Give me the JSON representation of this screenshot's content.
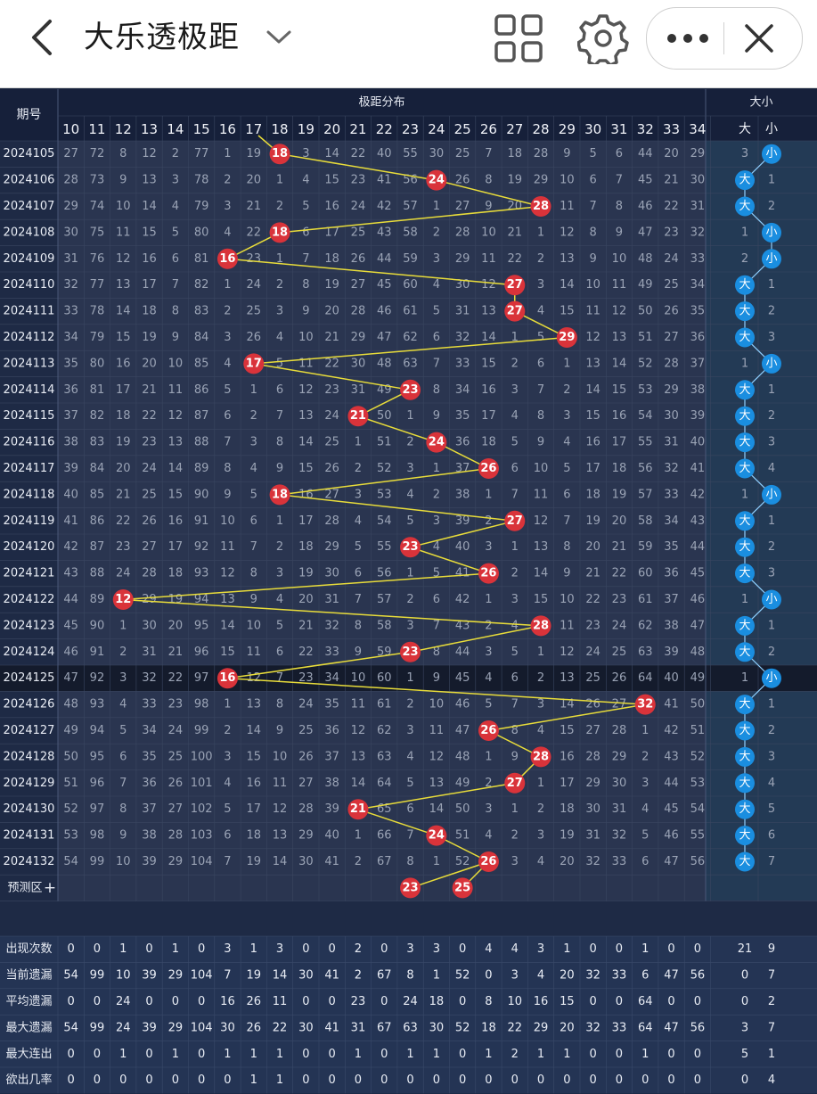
{
  "app": {
    "title": "大乐透极距",
    "back_icon": "back-arrow-icon",
    "dropdown_icon": "chevron-down-icon",
    "grid_icon": "grid-icon",
    "settings_icon": "gear-icon",
    "more_icon": "more-dots-icon",
    "close_icon": "close-icon"
  },
  "colors": {
    "bg": "#1c2740",
    "header_bg": "#16203a",
    "cell_bg": "#2a3550",
    "left_col": "#1e2a45",
    "highlight_row": "#141b2c",
    "ball_red": "#d9333a",
    "ball_blue": "#1a8ee0",
    "line": "#e8dc3a"
  },
  "table": {
    "period_header": "期号",
    "dist_header": "极距分布",
    "bigsmall_header": "大小",
    "columns": [
      "10",
      "11",
      "12",
      "13",
      "14",
      "15",
      "16",
      "17",
      "18",
      "19",
      "20",
      "21",
      "22",
      "23",
      "24",
      "25",
      "26",
      "27",
      "28",
      "29",
      "30",
      "31",
      "32",
      "33",
      "34"
    ],
    "bs_columns": [
      "大",
      "小"
    ],
    "highlight_row": "2024125",
    "rows": [
      {
        "p": "2024105",
        "v": [
          "27",
          "72",
          "8",
          "12",
          "2",
          "77",
          "1",
          "19",
          "18",
          "3",
          "14",
          "22",
          "40",
          "55",
          "30",
          "25",
          "7",
          "18",
          "28",
          "9",
          "5",
          "6",
          "44",
          "20",
          "29"
        ],
        "d": "3",
        "x": "小",
        "hit": "18"
      },
      {
        "p": "2024106",
        "v": [
          "28",
          "73",
          "9",
          "13",
          "3",
          "78",
          "2",
          "20",
          "1",
          "4",
          "15",
          "23",
          "41",
          "56",
          "24",
          "26",
          "8",
          "19",
          "29",
          "10",
          "6",
          "7",
          "45",
          "21",
          "30"
        ],
        "d": "大",
        "x": "1",
        "hit": "24"
      },
      {
        "p": "2024107",
        "v": [
          "29",
          "74",
          "10",
          "14",
          "4",
          "79",
          "3",
          "21",
          "2",
          "5",
          "16",
          "24",
          "42",
          "57",
          "1",
          "27",
          "9",
          "20",
          "28",
          "11",
          "7",
          "8",
          "46",
          "22",
          "31"
        ],
        "d": "大",
        "x": "2",
        "hit": "28"
      },
      {
        "p": "2024108",
        "v": [
          "30",
          "75",
          "11",
          "15",
          "5",
          "80",
          "4",
          "22",
          "18",
          "6",
          "17",
          "25",
          "43",
          "58",
          "2",
          "28",
          "10",
          "21",
          "1",
          "12",
          "8",
          "9",
          "47",
          "23",
          "32"
        ],
        "d": "1",
        "x": "小",
        "hit": "18"
      },
      {
        "p": "2024109",
        "v": [
          "31",
          "76",
          "12",
          "16",
          "6",
          "81",
          "16",
          "23",
          "1",
          "7",
          "18",
          "26",
          "44",
          "59",
          "3",
          "29",
          "11",
          "22",
          "2",
          "13",
          "9",
          "10",
          "48",
          "24",
          "33"
        ],
        "d": "2",
        "x": "小",
        "hit": "16"
      },
      {
        "p": "2024110",
        "v": [
          "32",
          "77",
          "13",
          "17",
          "7",
          "82",
          "1",
          "24",
          "2",
          "8",
          "19",
          "27",
          "45",
          "60",
          "4",
          "30",
          "12",
          "27",
          "3",
          "14",
          "10",
          "11",
          "49",
          "25",
          "34"
        ],
        "d": "大",
        "x": "1",
        "hit": "27"
      },
      {
        "p": "2024111",
        "v": [
          "33",
          "78",
          "14",
          "18",
          "8",
          "83",
          "2",
          "25",
          "3",
          "9",
          "20",
          "28",
          "46",
          "61",
          "5",
          "31",
          "13",
          "27",
          "4",
          "15",
          "11",
          "12",
          "50",
          "26",
          "35"
        ],
        "d": "大",
        "x": "2",
        "hit": "27"
      },
      {
        "p": "2024112",
        "v": [
          "34",
          "79",
          "15",
          "19",
          "9",
          "84",
          "3",
          "26",
          "4",
          "10",
          "21",
          "29",
          "47",
          "62",
          "6",
          "32",
          "14",
          "1",
          "5",
          "29",
          "12",
          "13",
          "51",
          "27",
          "36"
        ],
        "d": "大",
        "x": "3",
        "hit": "29"
      },
      {
        "p": "2024113",
        "v": [
          "35",
          "80",
          "16",
          "20",
          "10",
          "85",
          "4",
          "17",
          "5",
          "11",
          "22",
          "30",
          "48",
          "63",
          "7",
          "33",
          "15",
          "2",
          "6",
          "1",
          "13",
          "14",
          "52",
          "28",
          "37"
        ],
        "d": "1",
        "x": "小",
        "hit": "17"
      },
      {
        "p": "2024114",
        "v": [
          "36",
          "81",
          "17",
          "21",
          "11",
          "86",
          "5",
          "1",
          "6",
          "12",
          "23",
          "31",
          "49",
          "23",
          "8",
          "34",
          "16",
          "3",
          "7",
          "2",
          "14",
          "15",
          "53",
          "29",
          "38"
        ],
        "d": "大",
        "x": "1",
        "hit": "23"
      },
      {
        "p": "2024115",
        "v": [
          "37",
          "82",
          "18",
          "22",
          "12",
          "87",
          "6",
          "2",
          "7",
          "13",
          "24",
          "21",
          "50",
          "1",
          "9",
          "35",
          "17",
          "4",
          "8",
          "3",
          "15",
          "16",
          "54",
          "30",
          "39"
        ],
        "d": "大",
        "x": "2",
        "hit": "21"
      },
      {
        "p": "2024116",
        "v": [
          "38",
          "83",
          "19",
          "23",
          "13",
          "88",
          "7",
          "3",
          "8",
          "14",
          "25",
          "1",
          "51",
          "2",
          "24",
          "36",
          "18",
          "5",
          "9",
          "4",
          "16",
          "17",
          "55",
          "31",
          "40"
        ],
        "d": "大",
        "x": "3",
        "hit": "24"
      },
      {
        "p": "2024117",
        "v": [
          "39",
          "84",
          "20",
          "24",
          "14",
          "89",
          "8",
          "4",
          "9",
          "15",
          "26",
          "2",
          "52",
          "3",
          "1",
          "37",
          "26",
          "6",
          "10",
          "5",
          "17",
          "18",
          "56",
          "32",
          "41"
        ],
        "d": "大",
        "x": "4",
        "hit": "26"
      },
      {
        "p": "2024118",
        "v": [
          "40",
          "85",
          "21",
          "25",
          "15",
          "90",
          "9",
          "5",
          "18",
          "16",
          "27",
          "3",
          "53",
          "4",
          "2",
          "38",
          "1",
          "7",
          "11",
          "6",
          "18",
          "19",
          "57",
          "33",
          "42"
        ],
        "d": "1",
        "x": "小",
        "hit": "18"
      },
      {
        "p": "2024119",
        "v": [
          "41",
          "86",
          "22",
          "26",
          "16",
          "91",
          "10",
          "6",
          "1",
          "17",
          "28",
          "4",
          "54",
          "5",
          "3",
          "39",
          "2",
          "27",
          "12",
          "7",
          "19",
          "20",
          "58",
          "34",
          "43"
        ],
        "d": "大",
        "x": "1",
        "hit": "27"
      },
      {
        "p": "2024120",
        "v": [
          "42",
          "87",
          "23",
          "27",
          "17",
          "92",
          "11",
          "7",
          "2",
          "18",
          "29",
          "5",
          "55",
          "23",
          "4",
          "40",
          "3",
          "1",
          "13",
          "8",
          "20",
          "21",
          "59",
          "35",
          "44"
        ],
        "d": "大",
        "x": "2",
        "hit": "23"
      },
      {
        "p": "2024121",
        "v": [
          "43",
          "88",
          "24",
          "28",
          "18",
          "93",
          "12",
          "8",
          "3",
          "19",
          "30",
          "6",
          "56",
          "1",
          "5",
          "41",
          "26",
          "2",
          "14",
          "9",
          "21",
          "22",
          "60",
          "36",
          "45"
        ],
        "d": "大",
        "x": "3",
        "hit": "26"
      },
      {
        "p": "2024122",
        "v": [
          "44",
          "89",
          "12",
          "29",
          "19",
          "94",
          "13",
          "9",
          "4",
          "20",
          "31",
          "7",
          "57",
          "2",
          "6",
          "42",
          "1",
          "3",
          "15",
          "10",
          "22",
          "23",
          "61",
          "37",
          "46"
        ],
        "d": "1",
        "x": "小",
        "hit": "12"
      },
      {
        "p": "2024123",
        "v": [
          "45",
          "90",
          "1",
          "30",
          "20",
          "95",
          "14",
          "10",
          "5",
          "21",
          "32",
          "8",
          "58",
          "3",
          "7",
          "43",
          "2",
          "4",
          "28",
          "11",
          "23",
          "24",
          "62",
          "38",
          "47"
        ],
        "d": "大",
        "x": "1",
        "hit": "28"
      },
      {
        "p": "2024124",
        "v": [
          "46",
          "91",
          "2",
          "31",
          "21",
          "96",
          "15",
          "11",
          "6",
          "22",
          "33",
          "9",
          "59",
          "23",
          "8",
          "44",
          "3",
          "5",
          "1",
          "12",
          "24",
          "25",
          "63",
          "39",
          "48"
        ],
        "d": "大",
        "x": "2",
        "hit": "23"
      },
      {
        "p": "2024125",
        "v": [
          "47",
          "92",
          "3",
          "32",
          "22",
          "97",
          "16",
          "12",
          "7",
          "23",
          "34",
          "10",
          "60",
          "1",
          "9",
          "45",
          "4",
          "6",
          "2",
          "13",
          "25",
          "26",
          "64",
          "40",
          "49"
        ],
        "d": "1",
        "x": "小",
        "hit": "16"
      },
      {
        "p": "2024126",
        "v": [
          "48",
          "93",
          "4",
          "33",
          "23",
          "98",
          "1",
          "13",
          "8",
          "24",
          "35",
          "11",
          "61",
          "2",
          "10",
          "46",
          "5",
          "7",
          "3",
          "14",
          "26",
          "27",
          "32",
          "41",
          "50"
        ],
        "d": "大",
        "x": "1",
        "hit": "32"
      },
      {
        "p": "2024127",
        "v": [
          "49",
          "94",
          "5",
          "34",
          "24",
          "99",
          "2",
          "14",
          "9",
          "25",
          "36",
          "12",
          "62",
          "3",
          "11",
          "47",
          "26",
          "8",
          "4",
          "15",
          "27",
          "28",
          "1",
          "42",
          "51"
        ],
        "d": "大",
        "x": "2",
        "hit": "26"
      },
      {
        "p": "2024128",
        "v": [
          "50",
          "95",
          "6",
          "35",
          "25",
          "100",
          "3",
          "15",
          "10",
          "26",
          "37",
          "13",
          "63",
          "4",
          "12",
          "48",
          "1",
          "9",
          "28",
          "16",
          "28",
          "29",
          "2",
          "43",
          "52"
        ],
        "d": "大",
        "x": "3",
        "hit": "28"
      },
      {
        "p": "2024129",
        "v": [
          "51",
          "96",
          "7",
          "36",
          "26",
          "101",
          "4",
          "16",
          "11",
          "27",
          "38",
          "14",
          "64",
          "5",
          "13",
          "49",
          "2",
          "27",
          "1",
          "17",
          "29",
          "30",
          "3",
          "44",
          "53"
        ],
        "d": "大",
        "x": "4",
        "hit": "27"
      },
      {
        "p": "2024130",
        "v": [
          "52",
          "97",
          "8",
          "37",
          "27",
          "102",
          "5",
          "17",
          "12",
          "28",
          "39",
          "21",
          "65",
          "6",
          "14",
          "50",
          "3",
          "1",
          "2",
          "18",
          "30",
          "31",
          "4",
          "45",
          "54"
        ],
        "d": "大",
        "x": "5",
        "hit": "21"
      },
      {
        "p": "2024131",
        "v": [
          "53",
          "98",
          "9",
          "38",
          "28",
          "103",
          "6",
          "18",
          "13",
          "29",
          "40",
          "1",
          "66",
          "7",
          "24",
          "51",
          "4",
          "2",
          "3",
          "19",
          "31",
          "32",
          "5",
          "46",
          "55"
        ],
        "d": "大",
        "x": "6",
        "hit": "24"
      },
      {
        "p": "2024132",
        "v": [
          "54",
          "99",
          "10",
          "39",
          "29",
          "104",
          "7",
          "19",
          "14",
          "30",
          "41",
          "2",
          "67",
          "8",
          "1",
          "52",
          "26",
          "3",
          "4",
          "20",
          "32",
          "33",
          "6",
          "47",
          "56"
        ],
        "d": "大",
        "x": "7",
        "hit": "26"
      }
    ],
    "forecast": {
      "label": "预测区",
      "plus": "+",
      "balls": [
        "23",
        "25"
      ]
    },
    "stats": [
      {
        "label": "出现次数",
        "v": [
          "0",
          "0",
          "1",
          "0",
          "1",
          "0",
          "3",
          "1",
          "3",
          "0",
          "0",
          "2",
          "0",
          "3",
          "3",
          "0",
          "4",
          "4",
          "3",
          "1",
          "0",
          "0",
          "1",
          "0",
          "0"
        ],
        "d": "21",
        "x": "9"
      },
      {
        "label": "当前遗漏",
        "v": [
          "54",
          "99",
          "10",
          "39",
          "29",
          "104",
          "7",
          "19",
          "14",
          "30",
          "41",
          "2",
          "67",
          "8",
          "1",
          "52",
          "0",
          "3",
          "4",
          "20",
          "32",
          "33",
          "6",
          "47",
          "56"
        ],
        "d": "0",
        "x": "7"
      },
      {
        "label": "平均遗漏",
        "v": [
          "0",
          "0",
          "24",
          "0",
          "0",
          "0",
          "16",
          "26",
          "11",
          "0",
          "0",
          "23",
          "0",
          "24",
          "18",
          "0",
          "8",
          "10",
          "16",
          "15",
          "0",
          "0",
          "64",
          "0",
          "0"
        ],
        "d": "0",
        "x": "2"
      },
      {
        "label": "最大遗漏",
        "v": [
          "54",
          "99",
          "24",
          "39",
          "29",
          "104",
          "30",
          "26",
          "22",
          "30",
          "41",
          "31",
          "67",
          "63",
          "30",
          "52",
          "18",
          "22",
          "29",
          "20",
          "32",
          "33",
          "64",
          "47",
          "56"
        ],
        "d": "3",
        "x": "7"
      },
      {
        "label": "最大连出",
        "v": [
          "0",
          "0",
          "1",
          "0",
          "1",
          "0",
          "1",
          "1",
          "1",
          "0",
          "0",
          "1",
          "0",
          "1",
          "1",
          "0",
          "1",
          "2",
          "1",
          "1",
          "0",
          "0",
          "1",
          "0",
          "0"
        ],
        "d": "5",
        "x": "1"
      },
      {
        "label": "欲出几率",
        "v": [
          "0",
          "0",
          "0",
          "0",
          "0",
          "0",
          "0",
          "1",
          "1",
          "0",
          "0",
          "0",
          "0",
          "0",
          "0",
          "0",
          "0",
          "0",
          "0",
          "0",
          "0",
          "0",
          "0",
          "0",
          "0"
        ],
        "d": "0",
        "x": "4"
      }
    ]
  }
}
